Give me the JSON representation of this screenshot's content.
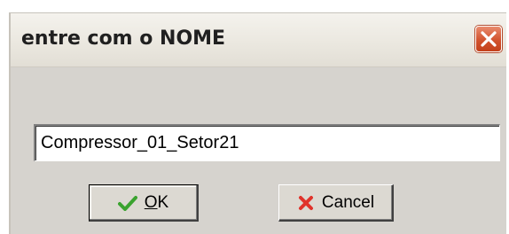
{
  "window": {
    "title": "entre com o NOME",
    "close_icon": "close-icon"
  },
  "input": {
    "value": "Compressor_01_Setor21"
  },
  "buttons": {
    "ok": {
      "label_underlined": "O",
      "label_rest": "K",
      "icon": "checkmark-icon",
      "icon_color": "#3aa32f"
    },
    "cancel": {
      "label": "Cancel",
      "icon": "x-icon",
      "icon_color": "#e0332b"
    }
  },
  "colors": {
    "dialog_bg": "#d6d3ce",
    "close_button": "#d2532e"
  }
}
